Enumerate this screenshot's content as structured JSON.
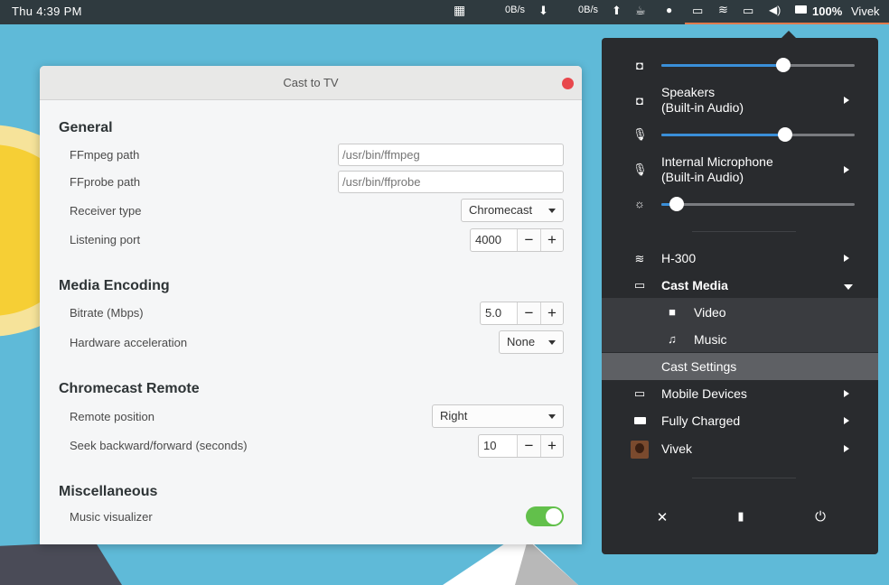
{
  "topbar": {
    "clock": "Thu  4:39 PM",
    "net_down": "0B/s",
    "net_up": "0B/s",
    "battery": "100%",
    "user": "Vivek"
  },
  "dialog": {
    "title": "Cast to TV",
    "sections": {
      "general": "General",
      "media_encoding": "Media Encoding",
      "chromecast_remote": "Chromecast Remote",
      "misc": "Miscellaneous"
    },
    "fields": {
      "ffmpeg_label": "FFmpeg path",
      "ffmpeg_placeholder": "/usr/bin/ffmpeg",
      "ffprobe_label": "FFprobe path",
      "ffprobe_placeholder": "/usr/bin/ffprobe",
      "receiver_label": "Receiver type",
      "receiver_value": "Chromecast",
      "port_label": "Listening port",
      "port_value": "4000",
      "bitrate_label": "Bitrate (Mbps)",
      "bitrate_value": "5.0",
      "hwaccel_label": "Hardware acceleration",
      "hwaccel_value": "None",
      "remote_pos_label": "Remote position",
      "remote_pos_value": "Right",
      "seek_label": "Seek backward/forward (seconds)",
      "seek_value": "10",
      "visualizer_label": "Music visualizer",
      "visualizer_on": true
    },
    "spin_minus": "−",
    "spin_plus": "+"
  },
  "menu": {
    "volume_level": 0.63,
    "mic_level": 0.64,
    "brightness_level": 0.08,
    "speakers_line1": "Speakers",
    "speakers_line2": "(Built-in Audio)",
    "mic_line1": "Internal Microphone",
    "mic_line2": "(Built-in Audio)",
    "wifi": "H-300",
    "cast_media": "Cast Media",
    "video": "Video",
    "music": "Music",
    "cast_settings": "Cast Settings",
    "mobile_devices": "Mobile Devices",
    "battery_status": "Fully Charged",
    "user": "Vivek"
  },
  "colors": {
    "accent": "#3a8fd9",
    "switch_on": "#62c04b",
    "close": "#e8474c",
    "panel": "#292b2e"
  },
  "icons": [
    "speaker-icon",
    "microphone-icon",
    "brightness-icon",
    "wifi-icon",
    "monitor-icon",
    "video-camera-icon",
    "music-note-icon",
    "mobile-devices-icon",
    "battery-icon",
    "settings-tools-icon",
    "lock-icon",
    "power-icon"
  ]
}
